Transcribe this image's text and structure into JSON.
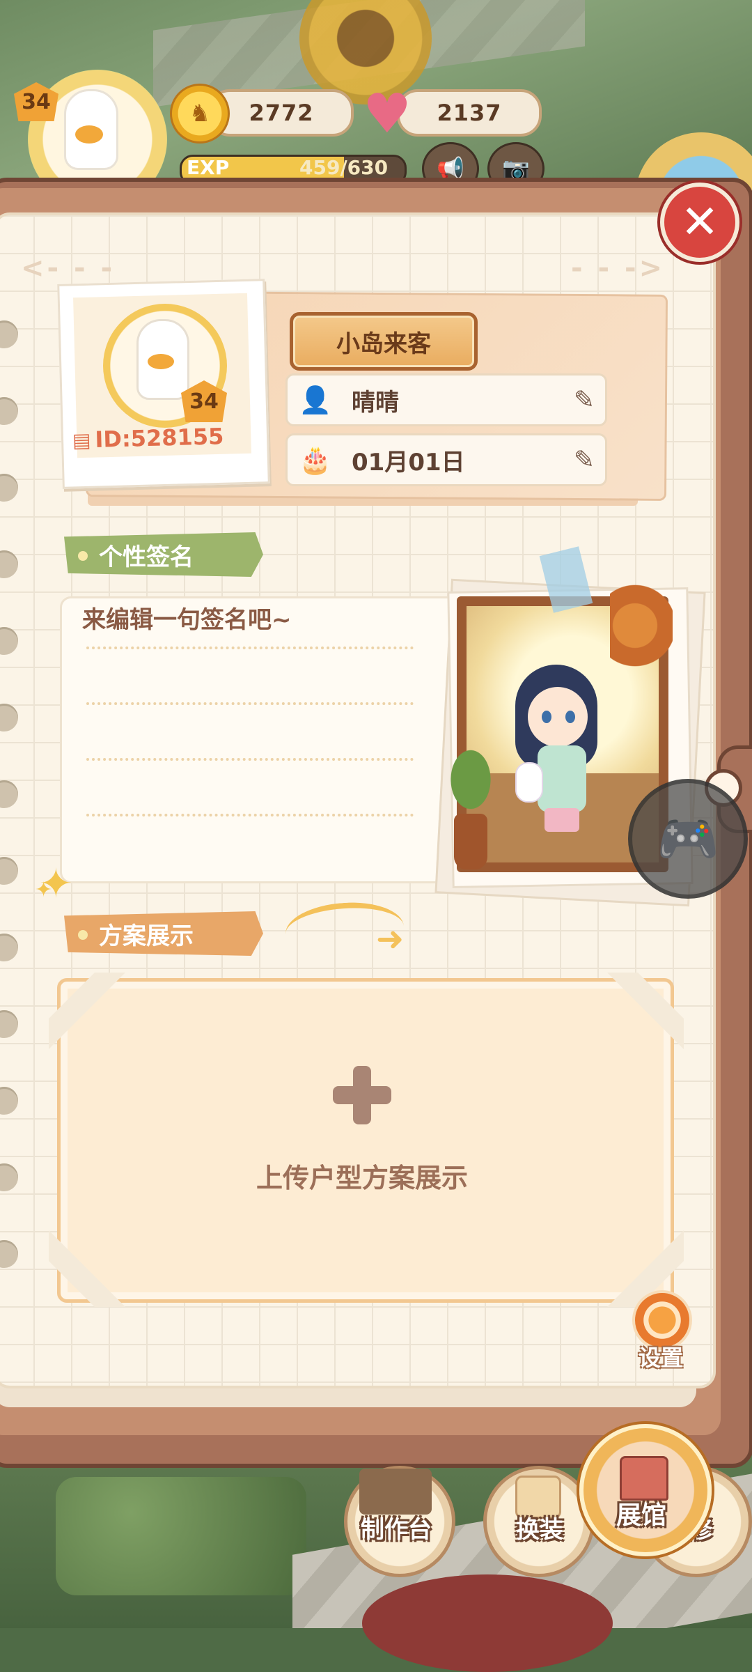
{
  "hud": {
    "player_level": "34",
    "coins": "2772",
    "hearts": "2137",
    "exp_label": "EXP",
    "exp_current": "459",
    "exp_total": "/630",
    "exp_fraction": 0.7286
  },
  "profile": {
    "avatar_level": "34",
    "player_id": "ID:528155",
    "title_badge": "小岛来客",
    "nickname": "晴晴",
    "birthday": "01月01日"
  },
  "signature": {
    "section_label": "个性签名",
    "placeholder": "来编辑一句签名吧~"
  },
  "scheme": {
    "section_label": "方案展示",
    "upload_label": "上传户型方案展示"
  },
  "settings": {
    "label": "设置"
  },
  "bottom_nav": {
    "craft": "制作台",
    "dress": "换装",
    "gallery": "展馆",
    "renovate": "装修"
  },
  "icons": {
    "close": "close-icon",
    "user": "user-icon",
    "cake": "cake-icon",
    "edit": "edit-icon",
    "gamepad": "gamepad-icon",
    "settings": "gear-icon",
    "coin": "coin-icon",
    "heart": "heart-icon"
  },
  "colors": {
    "close_red": "#d8453f",
    "signature_tag": "#9db56c",
    "scheme_tag": "#e8a768",
    "id_text": "#e06d4a"
  }
}
